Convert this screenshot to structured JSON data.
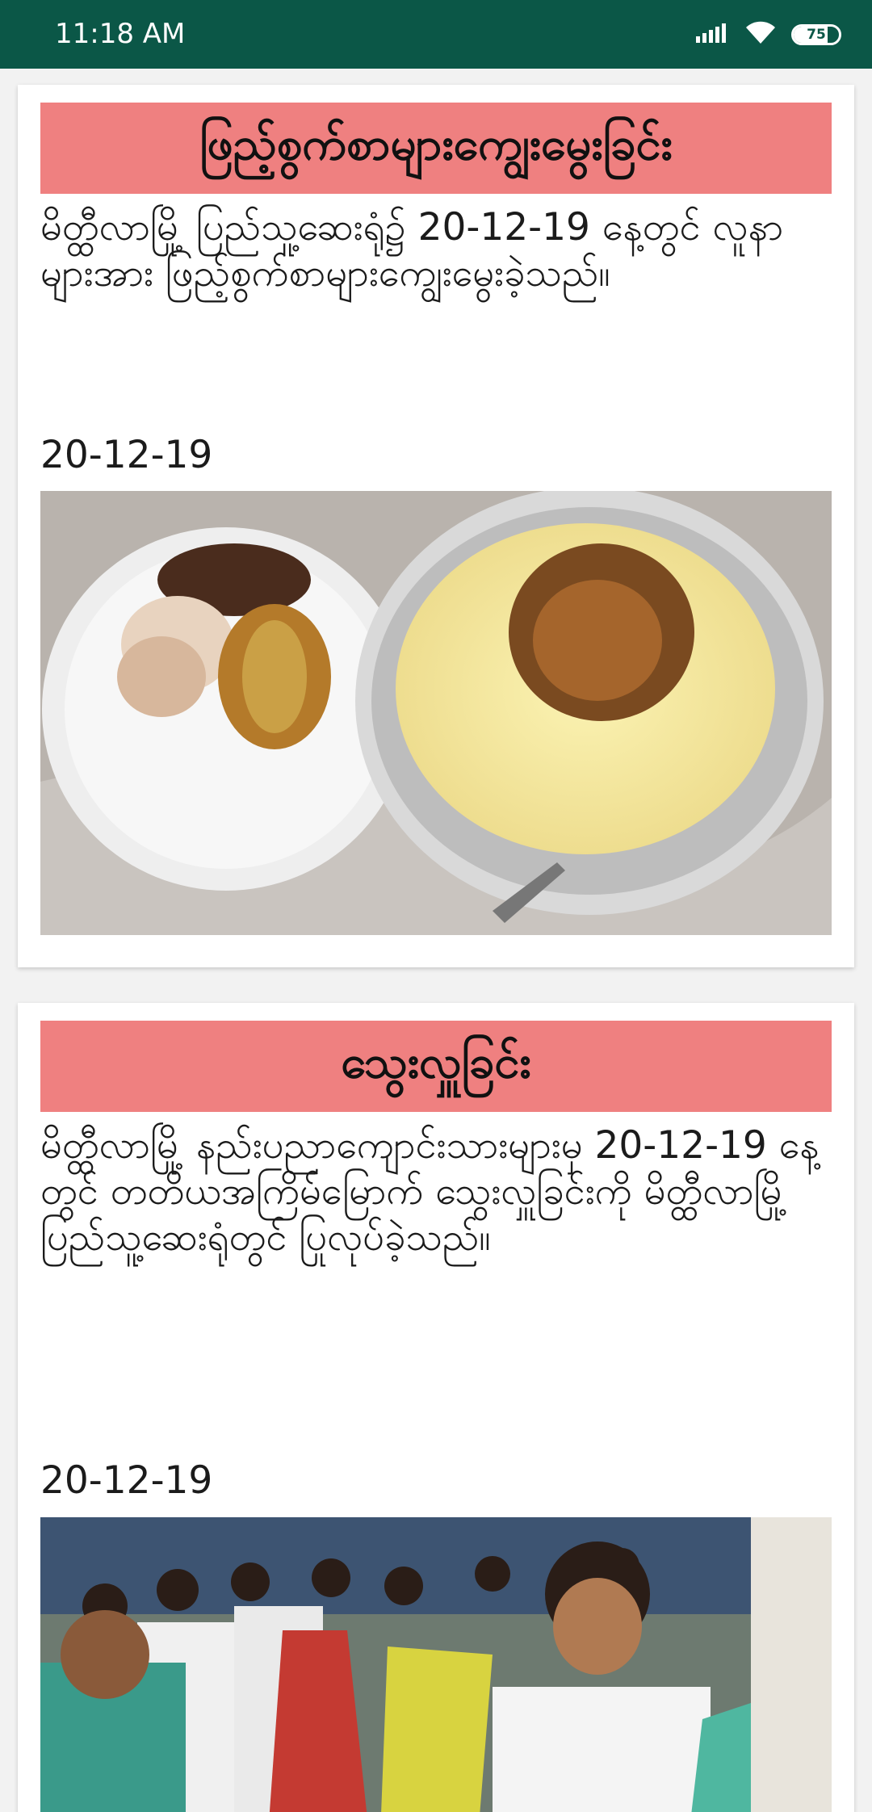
{
  "status_bar": {
    "time": "11:18 AM",
    "battery_level": "75",
    "icons": [
      "signal-icon",
      "wifi-icon",
      "battery-icon"
    ]
  },
  "colors": {
    "status_bar": "#0b5747",
    "card_header": "#ef8080",
    "background": "#f2f2f2"
  },
  "posts": [
    {
      "title": "ဖြည့်စွက်စာများကျွေးမွေးခြင်း",
      "body": "မိတ္ထီလာမြို့ ပြည်သူ့ဆေးရုံ၌ 20-12-19 နေ့တွင် လူနာများအား ဖြည့်စွက်စာများကျွေးမွေးခဲ့သည်။",
      "date": "20-12-19",
      "image": "food-plates-photo"
    },
    {
      "title": "သွေးလှူခြင်း",
      "body": "မိတ္ထီလာမြို့ နည်းပညာကျောင်းသားများမှ 20-12-19 နေ့တွင် တတိယအကြိမ်မြောက် သွေးလှူခြင်းကို မိတ္ထီလာမြို့ ပြည်သူ့ဆေးရုံတွင် ပြုလုပ်ခဲ့သည်။",
      "date": "20-12-19",
      "image": "students-group-photo"
    }
  ]
}
